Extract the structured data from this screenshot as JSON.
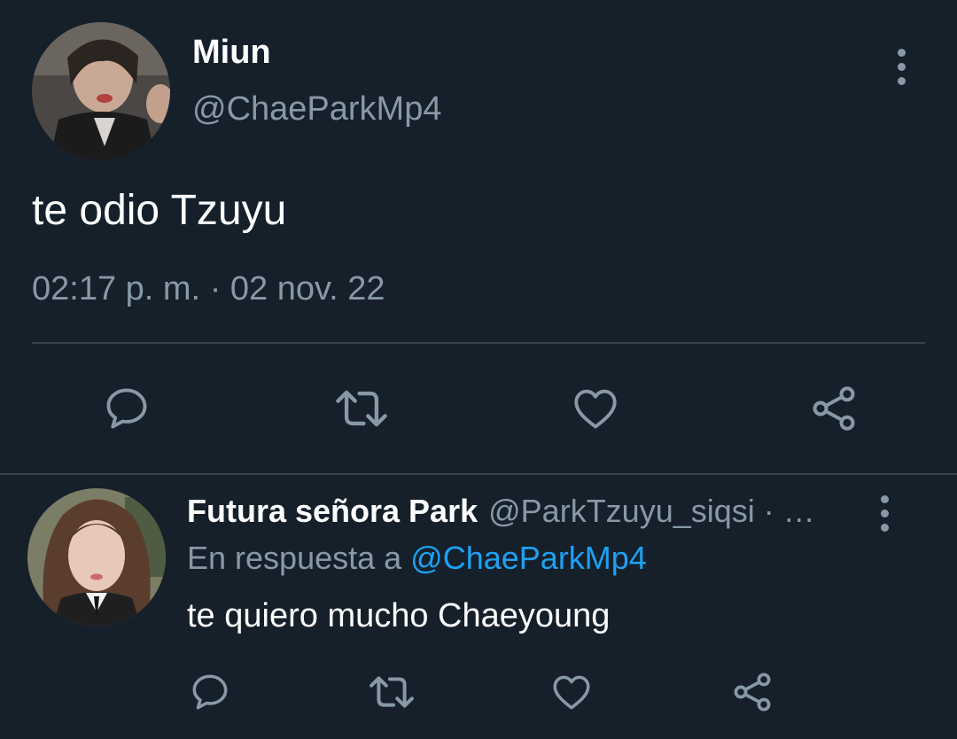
{
  "main_tweet": {
    "display_name": "Miun",
    "handle": "@ChaeParkMp4",
    "text": "te odio Tzuyu",
    "time": "02:17 p. m.",
    "separator": "·",
    "date": "02 nov. 22",
    "avatar_icon": "profile-photo-avatar",
    "actions": [
      "reply-icon",
      "retweet-icon",
      "like-icon",
      "share-icon"
    ]
  },
  "reply_tweet": {
    "display_name": "Futura señora Park",
    "handle": "@ParkTzuyu_siqsi · …",
    "replying_prefix": "En respuesta a",
    "replying_to": "@ChaeParkMp4",
    "text": "te quiero mucho Chaeyoung",
    "avatar_icon": "profile-photo-avatar",
    "actions": [
      "reply-icon",
      "retweet-icon",
      "like-icon",
      "share-icon"
    ]
  },
  "colors": {
    "background": "#15202b",
    "primary_text": "#ffffff",
    "secondary_text": "#8899a6",
    "divider": "#38444d",
    "mention": "#1da1f2",
    "icon": "#8899a6"
  }
}
